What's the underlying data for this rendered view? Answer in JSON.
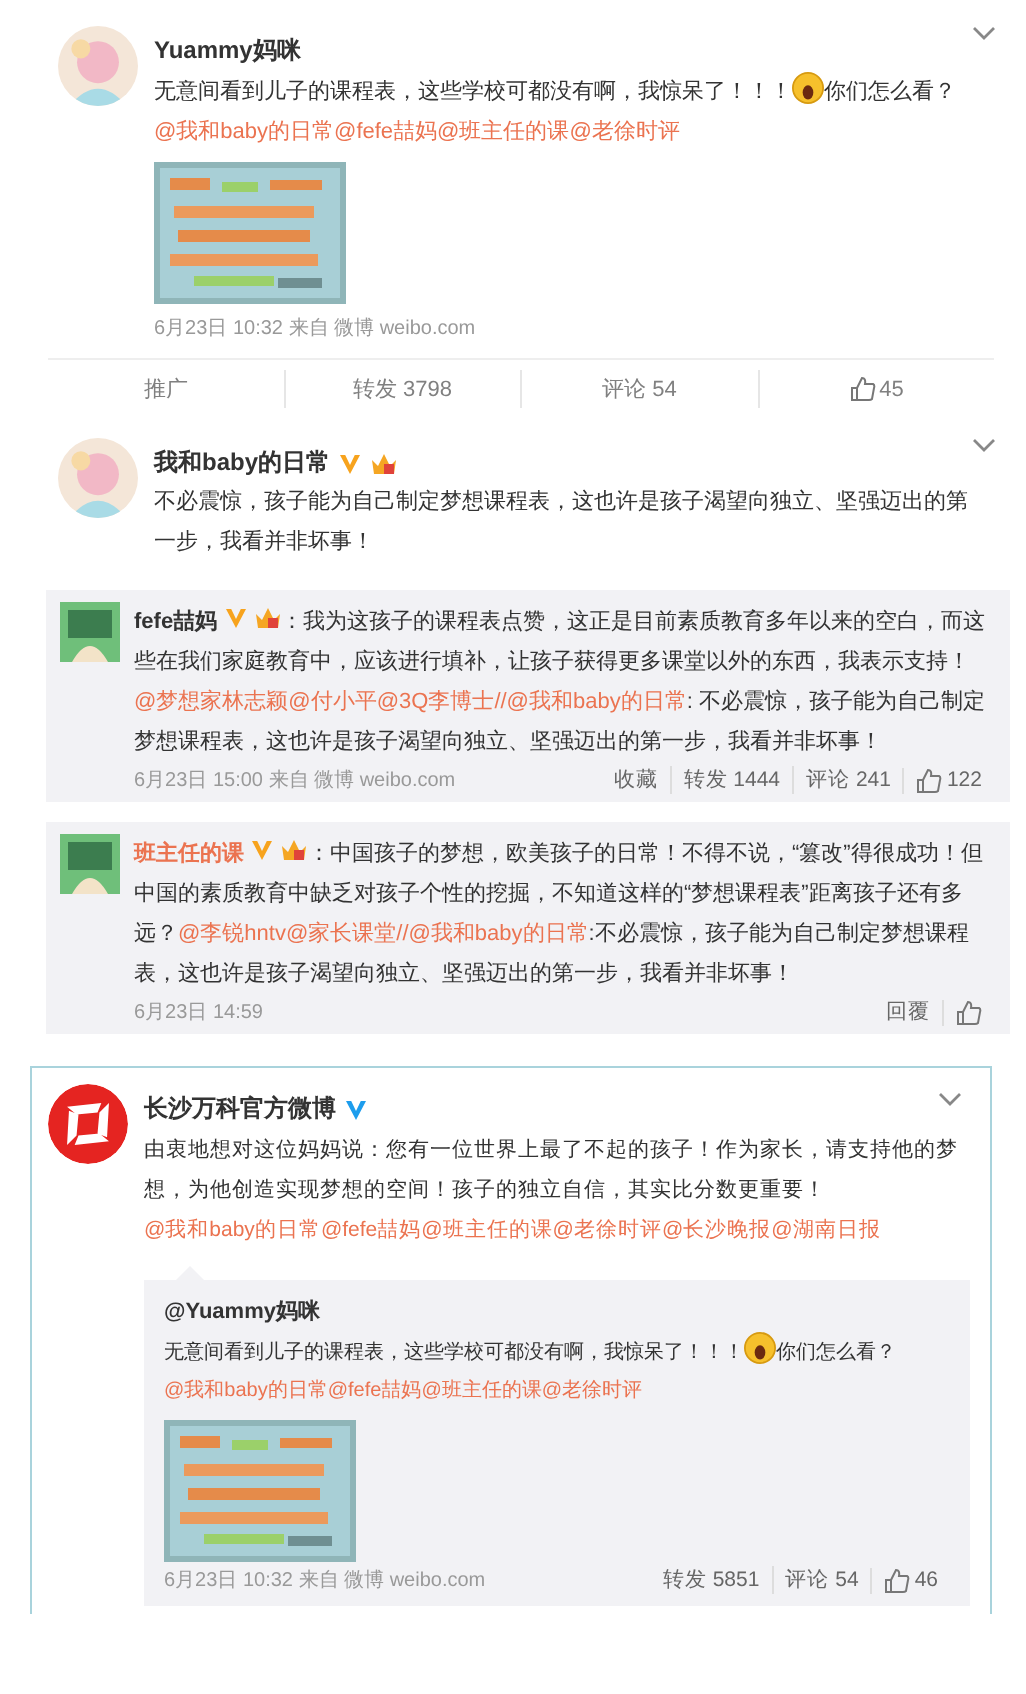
{
  "feed": [
    {
      "kind": "post",
      "name": "Yuammy妈咪",
      "avatar": {
        "kind": "picture"
      },
      "menu": true,
      "body": [
        {
          "kind": "text",
          "text": "无意间看到儿子的课程表，这些学校可都没有啊，我惊呆了！！！"
        },
        {
          "kind": "emoji"
        },
        {
          "kind": "text",
          "text": "你们怎么看？"
        },
        {
          "kind": "break"
        },
        {
          "kind": "mention",
          "text": "@我和baby的日常"
        },
        {
          "kind": "mention",
          "text": "@fefe喆妈"
        },
        {
          "kind": "mention",
          "text": "@班主任的课"
        },
        {
          "kind": "mention",
          "text": "@老徐时评"
        }
      ],
      "photo": true,
      "meta": "6月23日 10:32 来自 微博 weibo.com",
      "actions": [
        {
          "kind": "text",
          "label": "推广"
        },
        {
          "kind": "text",
          "label": "转发 3798"
        },
        {
          "kind": "text",
          "label": "评论 54"
        },
        {
          "kind": "like",
          "label": "45"
        }
      ]
    },
    {
      "kind": "post",
      "name": "我和baby的日常",
      "avatar": {
        "kind": "picture"
      },
      "badges": [
        {
          "kind": "v-gold"
        },
        {
          "kind": "vip"
        }
      ],
      "menu": true,
      "body": [
        {
          "kind": "text",
          "text": "不必震惊，孩子能为自己制定梦想课程表，这也许是孩子渴望向独立、坚强迈出的第一步，我看并非坏事！"
        }
      ],
      "photo": false
    },
    {
      "kind": "comment",
      "name": "fefe喆妈",
      "name_highlight": false,
      "badges": [
        {
          "kind": "v-gold"
        },
        {
          "kind": "vip"
        }
      ],
      "body": [
        {
          "kind": "text",
          "text": "：我为这孩子的课程表点赞，这正是目前素质教育多年以来的空白，而这些在我们家庭教育中，应该进行填补，让孩子获得更多课堂以外的东西，我表示支持！"
        },
        {
          "kind": "mention",
          "text": "@梦想家林志颖"
        },
        {
          "kind": "mention",
          "text": "@付小平"
        },
        {
          "kind": "mention",
          "text": "@3Q李博士"
        },
        {
          "kind": "mention",
          "text": "//@我和baby的日常"
        },
        {
          "kind": "text",
          "text": ": 不必震惊，孩子能为自己制定梦想课程表，这也许是孩子渴望向独立、坚强迈出的第一步，我看并非坏事！"
        }
      ],
      "meta": "6月23日 15:00 来自 微博 weibo.com",
      "actions": [
        {
          "kind": "text",
          "label": "收藏"
        },
        {
          "kind": "text",
          "label": "转发 1444"
        },
        {
          "kind": "text",
          "label": "评论 241"
        },
        {
          "kind": "like",
          "label": "122"
        }
      ]
    },
    {
      "kind": "comment",
      "name": "班主任的课",
      "name_highlight": true,
      "badges": [
        {
          "kind": "v-gold"
        },
        {
          "kind": "vip"
        }
      ],
      "body": [
        {
          "kind": "text",
          "text": "：中国孩子的梦想，欧美孩子的日常！不得不说，“篡改”得很成功！但中国的素质教育中缺乏对孩子个性的挖掘，不知道这样的“梦想课程表”距离孩子还有多远？"
        },
        {
          "kind": "mention",
          "text": "@李锐hntv"
        },
        {
          "kind": "mention",
          "text": "@家长课堂"
        },
        {
          "kind": "mention",
          "text": "//@我和baby的日常"
        },
        {
          "kind": "text",
          "text": ":不必震惊，孩子能为自己制定梦想课程表，这也许是孩子渴望向独立、坚强迈出的第一步，我看并非坏事！"
        }
      ],
      "meta": "6月23日 14:59",
      "actions": [
        {
          "kind": "text",
          "label": "回覆"
        },
        {
          "kind": "like"
        }
      ]
    },
    {
      "kind": "post",
      "name": "长沙万科官方微博",
      "avatar": {
        "kind": "logo"
      },
      "badges": [
        {
          "kind": "v-blue"
        }
      ],
      "menu": true,
      "boxed": true,
      "body": [
        {
          "kind": "text",
          "text": "由衷地想对这位妈妈说：您有一位世界上最了不起的孩子！作为家长，请支持他的梦想，为他创造实现梦想的空间！孩子的独立自信，其实比分数更重要！"
        },
        {
          "kind": "mention",
          "text": "@我和baby的日常"
        },
        {
          "kind": "mention",
          "text": "@fefe喆妈"
        },
        {
          "kind": "mention",
          "text": "@班主任的课"
        },
        {
          "kind": "mention",
          "text": "@老徐时评"
        },
        {
          "kind": "mention",
          "text": "@长沙晚报"
        },
        {
          "kind": "mention",
          "text": "@湖南日报"
        }
      ],
      "photo": false,
      "repost": {
        "name": "@Yuammy妈咪",
        "body": [
          {
            "kind": "text",
            "text": "无意间看到儿子的课程表，这些学校可都没有啊，我惊呆了！！！"
          },
          {
            "kind": "emoji"
          },
          {
            "kind": "text",
            "text": "你们怎么看？"
          },
          {
            "kind": "mention",
            "text": "@我和"
          },
          {
            "kind": "mention",
            "text": "baby的日常"
          },
          {
            "kind": "mention",
            "text": "@fefe喆妈"
          },
          {
            "kind": "mention",
            "text": "@班主任的课"
          },
          {
            "kind": "mention",
            "text": "@老徐时评"
          }
        ],
        "photo": true,
        "meta": "6月23日 10:32 来自 微博 weibo.com",
        "actions": [
          {
            "kind": "text",
            "label": "转发 5851"
          },
          {
            "kind": "text",
            "label": "评论 54"
          },
          {
            "kind": "like",
            "label": "46"
          }
        ]
      }
    }
  ]
}
